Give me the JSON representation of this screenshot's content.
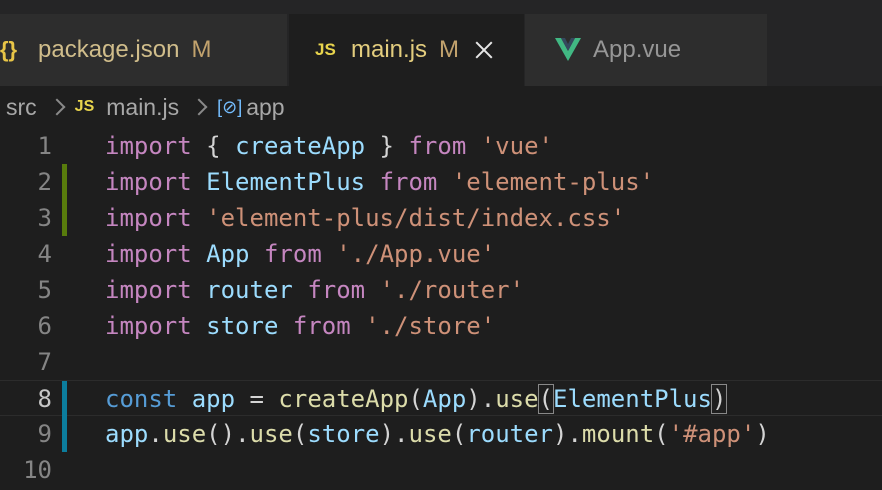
{
  "tabs": [
    {
      "icon": "{}",
      "icon_name": "json-braces-icon",
      "name": "package.json",
      "badge": "M"
    },
    {
      "icon": "JS",
      "icon_name": "javascript-icon",
      "name": "main.js",
      "badge": "M",
      "active": true
    },
    {
      "icon": "V",
      "icon_name": "vue-icon",
      "name": "App.vue"
    }
  ],
  "breadcrumb": {
    "folder": "src",
    "file_icon": "JS",
    "file": "main.js",
    "symbol_icon": "[⊘]",
    "symbol": "app"
  },
  "editor": {
    "line_numbers": [
      "1",
      "2",
      "3",
      "4",
      "5",
      "6",
      "7",
      "8",
      "9",
      "10"
    ],
    "current_line": 8,
    "git_added_lines": [
      2,
      3
    ],
    "git_modified_lines": [
      8,
      9
    ],
    "lines": [
      [
        [
          "kw",
          "import"
        ],
        [
          "pn",
          " { "
        ],
        [
          "var",
          "createApp"
        ],
        [
          "pn",
          " } "
        ],
        [
          "kw",
          "from"
        ],
        [
          "pn",
          " "
        ],
        [
          "str",
          "'vue'"
        ]
      ],
      [
        [
          "kw",
          "import"
        ],
        [
          "pn",
          " "
        ],
        [
          "var",
          "ElementPlus"
        ],
        [
          "pn",
          " "
        ],
        [
          "kw",
          "from"
        ],
        [
          "pn",
          " "
        ],
        [
          "str",
          "'element-plus'"
        ]
      ],
      [
        [
          "kw",
          "import"
        ],
        [
          "pn",
          " "
        ],
        [
          "str",
          "'element-plus/dist/index.css'"
        ]
      ],
      [
        [
          "kw",
          "import"
        ],
        [
          "pn",
          " "
        ],
        [
          "var",
          "App"
        ],
        [
          "pn",
          " "
        ],
        [
          "kw",
          "from"
        ],
        [
          "pn",
          " "
        ],
        [
          "str",
          "'./App.vue'"
        ]
      ],
      [
        [
          "kw",
          "import"
        ],
        [
          "pn",
          " "
        ],
        [
          "var",
          "router"
        ],
        [
          "pn",
          " "
        ],
        [
          "kw",
          "from"
        ],
        [
          "pn",
          " "
        ],
        [
          "str",
          "'./router'"
        ]
      ],
      [
        [
          "kw",
          "import"
        ],
        [
          "pn",
          " "
        ],
        [
          "var",
          "store"
        ],
        [
          "pn",
          " "
        ],
        [
          "kw",
          "from"
        ],
        [
          "pn",
          " "
        ],
        [
          "str",
          "'./store'"
        ]
      ],
      [],
      [
        [
          "kwb",
          "const"
        ],
        [
          "pn",
          " "
        ],
        [
          "var",
          "app"
        ],
        [
          "pn",
          " = "
        ],
        [
          "fn",
          "createApp"
        ],
        [
          "pn",
          "("
        ],
        [
          "var",
          "App"
        ],
        [
          "pn",
          ")."
        ],
        [
          "fn",
          "use"
        ],
        [
          "brk",
          "("
        ],
        [
          "var",
          "ElementPlus"
        ],
        [
          "brk",
          ")"
        ]
      ],
      [
        [
          "var",
          "app"
        ],
        [
          "pn",
          "."
        ],
        [
          "fn",
          "use"
        ],
        [
          "pn",
          "()."
        ],
        [
          "fn",
          "use"
        ],
        [
          "pn",
          "("
        ],
        [
          "var",
          "store"
        ],
        [
          "pn",
          ")."
        ],
        [
          "fn",
          "use"
        ],
        [
          "pn",
          "("
        ],
        [
          "var",
          "router"
        ],
        [
          "pn",
          ")."
        ],
        [
          "fn",
          "mount"
        ],
        [
          "pn",
          "("
        ],
        [
          "str",
          "'#app'"
        ],
        [
          "pn",
          ")"
        ]
      ],
      []
    ]
  },
  "colors": {
    "background": "#1e1e1e",
    "tab_inactive": "#2d2d2d",
    "tabbar": "#252526",
    "git_added": "#587c0c",
    "git_modified": "#0c7d9d",
    "keyword": "#c586c0",
    "keyword_blue": "#569cd6",
    "variable": "#9cdcfe",
    "function": "#dcdcaa",
    "string": "#ce9178",
    "vue_green": "#41b883"
  }
}
